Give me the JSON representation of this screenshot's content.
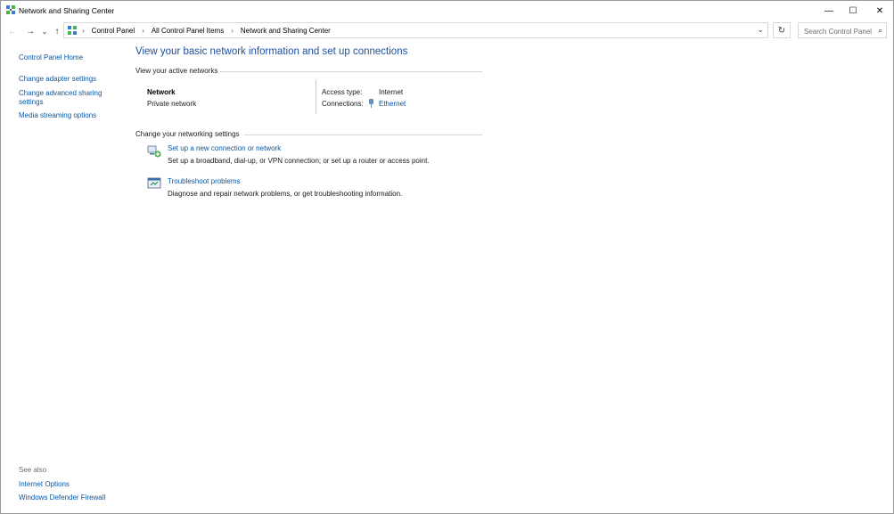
{
  "window": {
    "title": "Network and Sharing Center",
    "minimize_glyph": "—",
    "maximize_glyph": "☐",
    "close_glyph": "✕"
  },
  "nav": {
    "back_glyph": "←",
    "forward_glyph": "→",
    "recent_glyph": "⌄",
    "up_glyph": "↑",
    "address_icon": "control-panel-icon",
    "breadcrumbs": [
      "Control Panel",
      "All Control Panel Items",
      "Network and Sharing Center"
    ],
    "breadcrumb_sep": "›",
    "dropdown_glyph": "⌄",
    "refresh_glyph": "↻",
    "search_placeholder": "Search Control Panel",
    "search_glyph": "⌕"
  },
  "sidebar": {
    "home": "Control Panel Home",
    "adapter": "Change adapter settings",
    "sharing": "Change advanced sharing settings",
    "media": "Media streaming options",
    "see_also": "See also",
    "internet_options": "Internet Options",
    "firewall": "Windows Defender Firewall"
  },
  "main": {
    "title": "View your basic network information and set up connections",
    "active_networks_header": "View your active networks",
    "network": {
      "name": "Network",
      "type": "Private network",
      "access_type_label": "Access type:",
      "access_type_value": "Internet",
      "connections_label": "Connections:",
      "connections_value": "Ethernet"
    },
    "settings_header": "Change your networking settings",
    "tasks": [
      {
        "icon": "new-connection-icon",
        "link": "Set up a new connection or network",
        "description": "Set up a broadband, dial-up, or VPN connection; or set up a router or access point."
      },
      {
        "icon": "troubleshoot-icon",
        "link": "Troubleshoot problems",
        "description": "Diagnose and repair network problems, or get troubleshooting information."
      }
    ]
  },
  "colors": {
    "link": "#0a57a4",
    "title": "#1e4e9c"
  }
}
